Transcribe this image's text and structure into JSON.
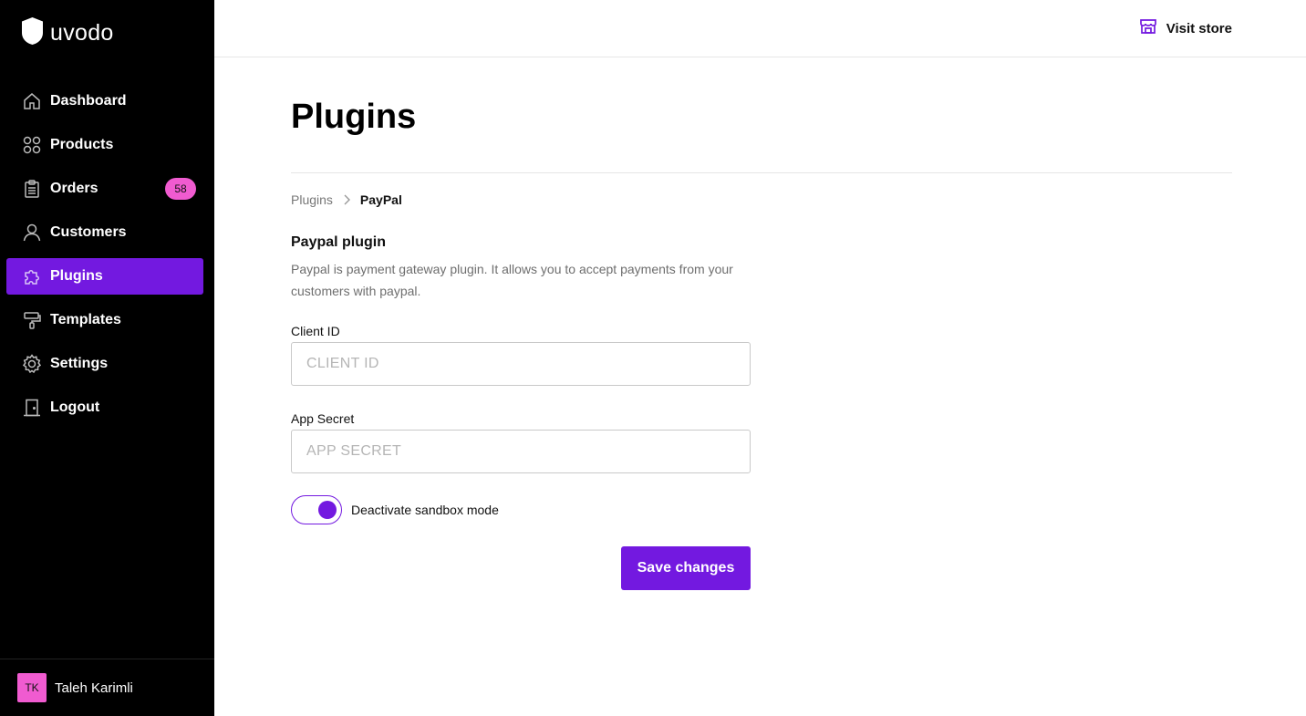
{
  "brand": {
    "name": "uvodo",
    "icon": "shield-logo-icon"
  },
  "nav": {
    "items": [
      {
        "label": "Dashboard",
        "icon": "home-icon",
        "active": false
      },
      {
        "label": "Products",
        "icon": "grid-icon",
        "active": false
      },
      {
        "label": "Orders",
        "icon": "clipboard-icon",
        "active": false,
        "badge": "58"
      },
      {
        "label": "Customers",
        "icon": "user-icon",
        "active": false
      },
      {
        "label": "Plugins",
        "icon": "puzzle-icon",
        "active": true
      },
      {
        "label": "Templates",
        "icon": "paint-roller-icon",
        "active": false
      },
      {
        "label": "Settings",
        "icon": "gear-icon",
        "active": false
      },
      {
        "label": "Logout",
        "icon": "door-icon",
        "active": false
      }
    ]
  },
  "user": {
    "initials": "TK",
    "name": "Taleh Karimli"
  },
  "topbar": {
    "visit_store_label": "Visit store",
    "visit_store_icon": "store-icon"
  },
  "page": {
    "title": "Plugins"
  },
  "breadcrumb": {
    "parent": "Plugins",
    "current": "PayPal"
  },
  "plugin": {
    "title": "Paypal plugin",
    "description": "Paypal is payment gateway plugin. It allows you to accept payments from your customers with paypal."
  },
  "form": {
    "client_id": {
      "label": "Client ID",
      "value": "",
      "placeholder": "CLIENT ID"
    },
    "app_secret": {
      "label": "App Secret",
      "value": "",
      "placeholder": "APP SECRET"
    },
    "sandbox_toggle": {
      "label": "Deactivate sandbox mode",
      "on": true
    },
    "save_label": "Save changes"
  },
  "colors": {
    "accent": "#7319e0",
    "badge": "#f05bd0",
    "sidebar_bg": "#000000"
  }
}
